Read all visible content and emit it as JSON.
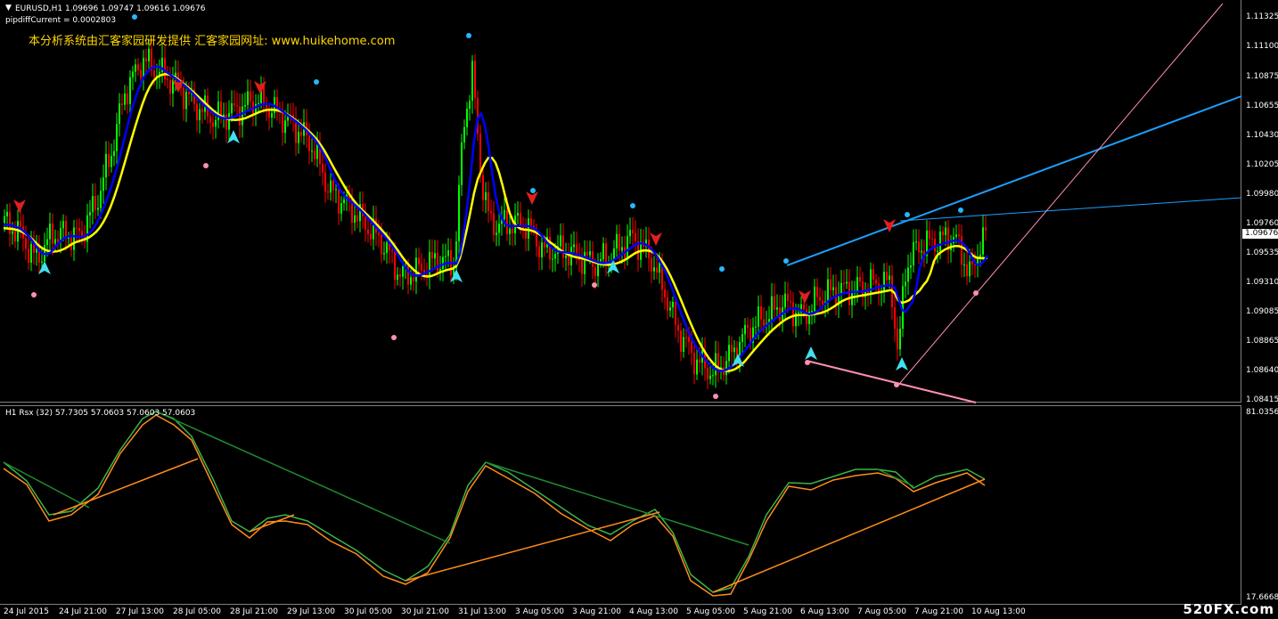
{
  "window": {
    "symbol_header": "EURUSD,H1  1.09696 1.09747 1.09616 1.09676",
    "indicator_readout": "pipdiffCurrent = 0.0002803",
    "promo_text_cn": "本分析系统由汇客家园研发提供 汇客家园网址: ",
    "promo_url": "www.huikehome.com",
    "menu_arrow": "triangle-down-icon"
  },
  "price_axis": {
    "labels": [
      "1.11325",
      "1.11100",
      "1.10875",
      "1.10655",
      "1.10430",
      "1.10205",
      "1.09980",
      "1.09760",
      "1.09535",
      "1.09310",
      "1.09085",
      "1.08865",
      "1.08640",
      "1.08415"
    ],
    "current": "1.09676"
  },
  "subwindow": {
    "header": "H1  Rsx (32) 57.7305 57.0603 57.0603 57.0603",
    "axis_top": "81.0356",
    "axis_bottom": "17.6668"
  },
  "time_axis": [
    "24 Jul 2015",
    "24 Jul 21:00",
    "27 Jul 13:00",
    "28 Jul 05:00",
    "28 Jul 21:00",
    "29 Jul 13:00",
    "30 Jul 05:00",
    "30 Jul 21:00",
    "31 Jul 13:00",
    "3 Aug 05:00",
    "3 Aug 21:00",
    "4 Aug 13:00",
    "5 Aug 05:00",
    "5 Aug 21:00",
    "6 Aug 13:00",
    "7 Aug 05:00",
    "7 Aug 21:00",
    "10 Aug 13:00"
  ],
  "watermark": "520FX.com",
  "colors": {
    "bull": "#00ff00",
    "bear": "#ff0000",
    "ma_fast": "#0000ff",
    "ma_slow": "#ffff00",
    "trend_blue": "#1e9fff",
    "trend_pink": "#ff8fb0",
    "rsx_green": "#3cb34a",
    "rsx_orange": "#ff8c1a"
  }
}
